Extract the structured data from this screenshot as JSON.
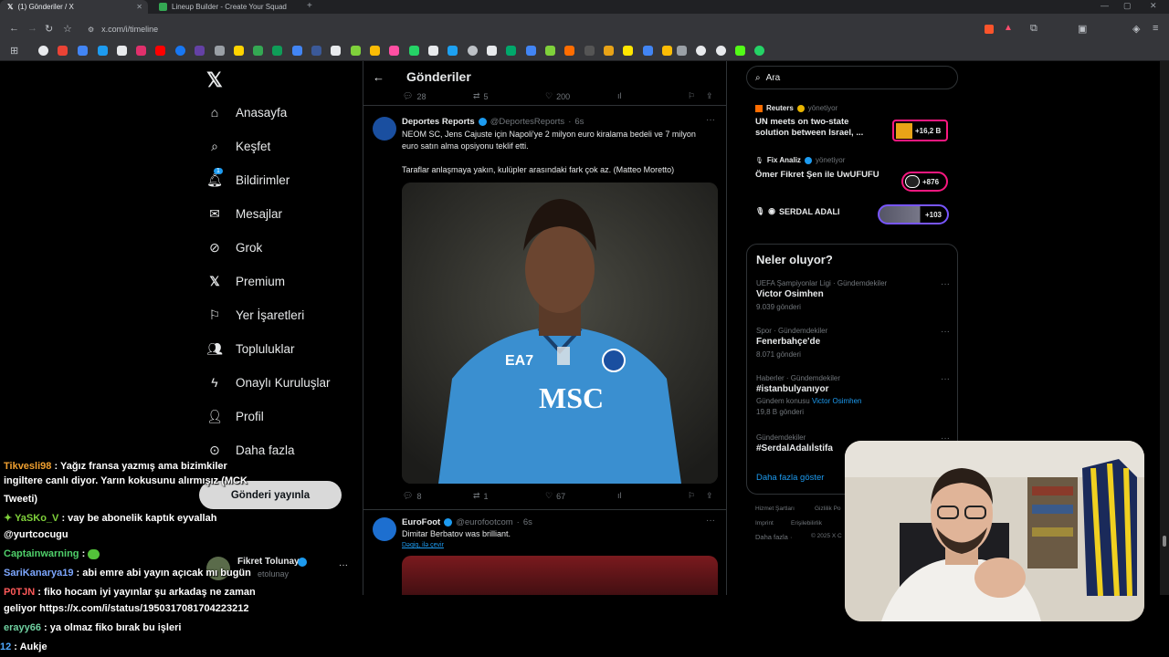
{
  "browser": {
    "tabs": [
      {
        "label": "(1) Gönderiler / X",
        "active": true
      },
      {
        "label": "Lineup Builder - Create Your Squad",
        "active": false
      }
    ],
    "url": "x.com/i/timeline"
  },
  "nav": {
    "items": [
      {
        "label": "Anasayfa",
        "icon": "home-icon"
      },
      {
        "label": "Keşfet",
        "icon": "search-icon"
      },
      {
        "label": "Bildirimler",
        "icon": "bell-icon",
        "badge": "1"
      },
      {
        "label": "Mesajlar",
        "icon": "mail-icon"
      },
      {
        "label": "Grok",
        "icon": "grok-icon"
      },
      {
        "label": "Premium",
        "icon": "x-icon"
      },
      {
        "label": "Yer İşaretleri",
        "icon": "bookmark-icon"
      },
      {
        "label": "Topluluklar",
        "icon": "people-icon"
      },
      {
        "label": "Onaylı Kuruluşlar",
        "icon": "bolt-icon"
      },
      {
        "label": "Profil",
        "icon": "person-icon"
      },
      {
        "label": "Daha fazla",
        "icon": "more-circle-icon"
      }
    ],
    "post_button": "Gönderi yayınla",
    "account": {
      "name": "Fikret Tolunay",
      "handle": "etolunay"
    }
  },
  "timeline": {
    "title": "Gönderiler",
    "top_actions": {
      "replies": "28",
      "reposts": "5",
      "likes": "200"
    },
    "post1": {
      "author": "Deportes Reports",
      "handle": "@DeportesReports",
      "time": "6s",
      "text1": "NEOM SC, Jens Cajuste için Napoli'ye 2 milyon euro kiralama bedeli ve 7 milyon euro satın alma opsiyonu teklif etti.",
      "text2": "Taraflar anlaşmaya yakın, kulüpler arasındaki fark çok az. (Matteo Moretto)",
      "image_text": "MSC",
      "replies": "8",
      "reposts": "1",
      "likes": "67"
    },
    "post2": {
      "author": "EuroFoot",
      "handle": "@eurofootcom",
      "time": "6s",
      "text": "Dimitar Berbatov was brilliant.",
      "translate": "Dəqiq, ilə çevir"
    }
  },
  "right": {
    "search_placeholder": "Ara",
    "live": [
      {
        "source": "Reuters",
        "status": "yönetiyor",
        "title": "UN meets on two-state solution between Israel, ...",
        "count": "+16,2 B"
      },
      {
        "source": "Fix Analiz",
        "status": "yönetiyor",
        "title": "Ömer Fikret Şen ile UwUFUFU",
        "count": "+876"
      },
      {
        "source": "SERDAL ADALI",
        "status": "",
        "title": "",
        "count": "+103"
      }
    ],
    "trends_title": "Neler oluyor?",
    "trends": [
      {
        "meta": "UEFA Şampiyonlar Ligi · Gündemdekiler",
        "title": "Victor Osimhen",
        "count": "9.039 gönderi"
      },
      {
        "meta": "Spor · Gündemdekiler",
        "title": "Fenerbahçe'de",
        "count": "8.071 gönderi"
      },
      {
        "meta": "Haberler · Gündemdekiler",
        "title": "#istanbulyanıyor",
        "extra": "Gündem konusu",
        "extra_link": "Victor Osimhen",
        "count": "19,8 B gönderi"
      },
      {
        "meta": "Gündemdekiler",
        "title": "#SerdalAdalıİstifa",
        "count": ""
      }
    ],
    "show_more": "Daha fazla göster",
    "footer": [
      "Hizmet Şartları",
      "Gizlilik Po",
      "Imprint",
      "Erişilebilirlik",
      "Daha fazla ·",
      "© 2025 X C"
    ]
  },
  "chat": [
    {
      "user": "Tikvesli98",
      "color": "#f0a030",
      "text": " : Yağız fransa yazmış ama bizimkiler"
    },
    {
      "user": "",
      "color": "#ffffff",
      "text": "ingiltere canlı diyor. Yarın kokusunu alırmışız (MCK"
    },
    {
      "user": "",
      "color": "#ffffff",
      "text": "Tweeti)"
    },
    {
      "user": "YaSKo_V",
      "color": "#7fd13b",
      "text": " : vay be abonelik kaptık eyvallah"
    },
    {
      "user": "",
      "color": "#ffffff",
      "text": "@yurtcocugu"
    },
    {
      "user": "Captainwarning",
      "color": "#4fd06a",
      "text": " :"
    },
    {
      "user": "SariKanarya19",
      "color": "#7da7ff",
      "text": " : abi emre abi yayın açıcak mı bugün"
    },
    {
      "user": "P0TJN",
      "color": "#ff5a5a",
      "text": " : fiko hocam iyi yayınlar şu arkadaş ne zaman"
    },
    {
      "user": "",
      "color": "#ffffff",
      "text": "geliyor https://x.com/i/status/1950317081704223212"
    },
    {
      "user": "erayy66",
      "color": "#6fd0a0",
      "text": " : ya olmaz fiko bırak bu işleri"
    },
    {
      "user": "12",
      "color": "#4fa8ff",
      "text": " : Aukje"
    }
  ],
  "colors": {
    "accent": "#1d9bf0",
    "bg": "#000000",
    "border": "#2f3336",
    "muted": "#71767b"
  }
}
